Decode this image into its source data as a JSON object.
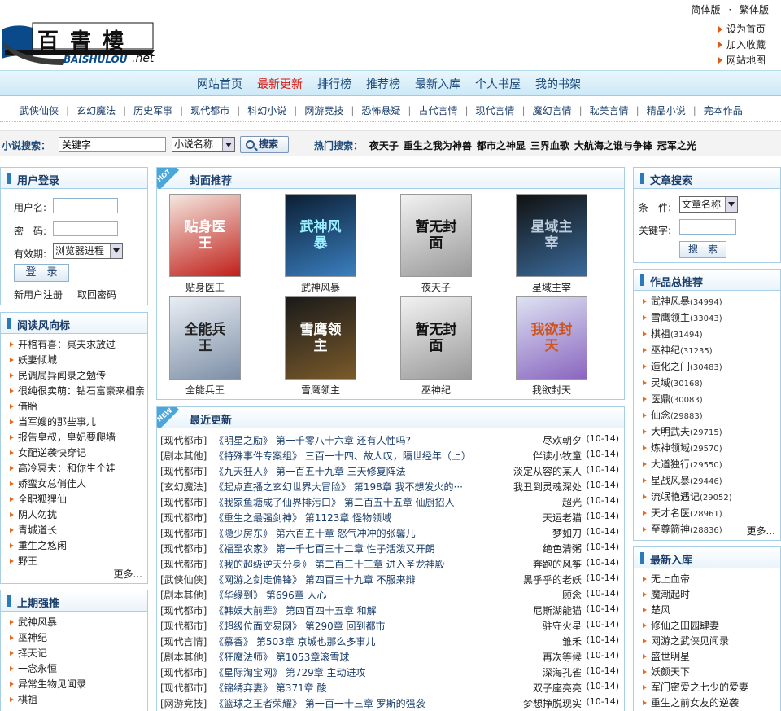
{
  "header": {
    "logo_text": "百書樓",
    "logo_sub": "BAISHULOU",
    "logo_tld": ".net",
    "lang_simplified": "简体版",
    "lang_dot": "·",
    "lang_traditional": "繁体版",
    "links": [
      "设为首页",
      "加入收藏",
      "网站地图"
    ]
  },
  "main_nav": [
    "网站首页",
    "最新更新",
    "排行榜",
    "推荐榜",
    "最新入库",
    "个人书屋",
    "我的书架"
  ],
  "main_nav_active": "最新更新",
  "categories": [
    "武侠仙侠",
    "玄幻魔法",
    "历史军事",
    "现代都市",
    "科幻小说",
    "网游竞技",
    "恐怖悬疑",
    "古代言情",
    "现代言情",
    "魔幻言情",
    "耽美言情",
    "精品小说",
    "完本作品"
  ],
  "search": {
    "label": "小说搜索：",
    "value": "关键字",
    "type": "小说名称",
    "button": "搜索",
    "hot_label": "热门搜索：",
    "hot": [
      "夜天子",
      "重生之我为神兽",
      "都市之神显",
      "三界血歌",
      "大航海之谁与争锋",
      "冠军之光"
    ]
  },
  "login": {
    "title": "用户登录",
    "username_label": "用户名:",
    "password_label": "密　码:",
    "expiry_label": "有效期:",
    "expiry_value": "浏览器进程",
    "submit": "登　录",
    "register": "新用户注册",
    "recover": "取回密码"
  },
  "reading_trend": {
    "title": "阅读风向标",
    "items": [
      "开棺有喜：冥夫求放过",
      "妖妻倾城",
      "民调局异闻录之勉传",
      "很纯很卖萌：钻石富豪来相亲",
      "借胎",
      "当军嫂的那些事儿",
      "报告皇叔，皇妃要爬墙",
      "女配逆袭快穿记",
      "高冷冥夫：和你生个娃",
      "娇蛮女总俏佳人",
      "全职狐狸仙",
      "阴人勿扰",
      "青城道长",
      "重生之悠闲",
      "野王"
    ],
    "more": "更多..."
  },
  "last_period": {
    "title": "上期强推",
    "items": [
      "武神风暴",
      "巫神纪",
      "择天记",
      "一念永恒",
      "异常生物见闻录",
      "棋祖"
    ]
  },
  "cover_rec": {
    "title": "封面推荐",
    "ribbon": "HOT",
    "books": [
      {
        "name": "贴身医王",
        "cover_text": "贴身医王"
      },
      {
        "name": "武神风暴",
        "cover_text": "武神风暴"
      },
      {
        "name": "夜天子",
        "cover_text": "暂无封面"
      },
      {
        "name": "星域主宰",
        "cover_text": "星域主宰"
      },
      {
        "name": "全能兵王",
        "cover_text": "全能兵王"
      },
      {
        "name": "雪鹰领主",
        "cover_text": "雪鹰领主"
      },
      {
        "name": "巫神纪",
        "cover_text": "暂无封面"
      },
      {
        "name": "我欲封天",
        "cover_text": "我欲封天"
      }
    ]
  },
  "latest": {
    "title": "最近更新",
    "ribbon": "NEW",
    "rows": [
      {
        "cat": "[现代都市]",
        "book": "《明星之励》 第一千零八十六章 还有人性吗?",
        "author": "尽欢朝夕",
        "date": "(10-14)"
      },
      {
        "cat": "[剧本其他]",
        "book": "《特殊事件专案组》 三百一十四、故人叹，隔世经年（上）",
        "author": "伴读小牧童",
        "date": "(10-14)"
      },
      {
        "cat": "[现代都市]",
        "book": "《九天狂人》 第一百五十九章 三天修复阵法",
        "author": "淡定从容的某人",
        "date": "(10-14)"
      },
      {
        "cat": "[玄幻魔法]",
        "book": "《起点直播之玄幻世界大冒险》 第198章 我不想发火的···",
        "author": "我丑到灵魂深处",
        "date": "(10-14)"
      },
      {
        "cat": "[现代都市]",
        "book": "《我家鱼塘成了仙界排污口》 第二百五十五章 仙厨招人",
        "author": "超光",
        "date": "(10-14)"
      },
      {
        "cat": "[现代都市]",
        "book": "《重生之最强剑神》 第1123章 怪物领域",
        "author": "天运老猫",
        "date": "(10-14)"
      },
      {
        "cat": "[现代都市]",
        "book": "《隐少房东》 第六百五十章 怒气冲冲的张馨儿",
        "author": "梦如刀",
        "date": "(10-14)"
      },
      {
        "cat": "[现代都市]",
        "book": "《福至农家》 第一千七百三十二章 性子活泼又开朗",
        "author": "绝色清粥",
        "date": "(10-14)"
      },
      {
        "cat": "[现代都市]",
        "book": "《我的超级逆天分身》 第二百三十三章 进入圣龙神殿",
        "author": "奔跑的风筝",
        "date": "(10-14)"
      },
      {
        "cat": "[武侠仙侠]",
        "book": "《网游之剑走偏锋》 第四百三十九章 不服来辩",
        "author": "黑乎乎的老妖",
        "date": "(10-14)"
      },
      {
        "cat": "[剧本其他]",
        "book": "《华缘到》 第696章 人心",
        "author": "顾念",
        "date": "(10-14)"
      },
      {
        "cat": "[现代都市]",
        "book": "《韩娱大前辈》 第四百四十五章 和解",
        "author": "尼斯湖能猫",
        "date": "(10-14)"
      },
      {
        "cat": "[现代都市]",
        "book": "《超级位面交易网》 第290章 回到都市",
        "author": "驻守火星",
        "date": "(10-14)"
      },
      {
        "cat": "[现代言情]",
        "book": "《慕香》 第503章 京城也那么多事儿",
        "author": "雏禾",
        "date": "(10-14)"
      },
      {
        "cat": "[剧本其他]",
        "book": "《狂魔法师》 第1053章滚雪球",
        "author": "再次等候",
        "date": "(10-14)"
      },
      {
        "cat": "[现代都市]",
        "book": "《星际淘宝网》 第729章 主动进攻",
        "author": "深海孔雀",
        "date": "(10-14)"
      },
      {
        "cat": "[现代都市]",
        "book": "《锦绣弃妻》 第371章 酸",
        "author": "双子座亮亮",
        "date": "(10-14)"
      },
      {
        "cat": "[网游竞技]",
        "book": "《篮球之王者荣耀》 第一百一十三章 罗斯的强袭",
        "author": "梦想挣脱现实",
        "date": "(10-14)"
      }
    ]
  },
  "article_search": {
    "title": "文章搜索",
    "cond_label": "条　件:",
    "cond_value": "文章名称",
    "kw_label": "关键字:",
    "button": "搜　索"
  },
  "overall_rec": {
    "title": "作品总推荐",
    "items": [
      {
        "name": "武神风暴",
        "count": "(34994)"
      },
      {
        "name": "雪鹰领主",
        "count": "(33043)"
      },
      {
        "name": "棋祖",
        "count": "(31494)"
      },
      {
        "name": "巫神纪",
        "count": "(31235)"
      },
      {
        "name": "造化之门",
        "count": "(30483)"
      },
      {
        "name": "灵域",
        "count": "(30168)"
      },
      {
        "name": "医鼎",
        "count": "(30083)"
      },
      {
        "name": "仙念",
        "count": "(29883)"
      },
      {
        "name": "大明武夫",
        "count": "(29715)"
      },
      {
        "name": "炼神领域",
        "count": "(29570)"
      },
      {
        "name": "大道独行",
        "count": "(29550)"
      },
      {
        "name": "星战风暴",
        "count": "(29446)"
      },
      {
        "name": "流氓艳遇记",
        "count": "(29052)"
      },
      {
        "name": "天才名医",
        "count": "(28961)"
      },
      {
        "name": "至尊箭神",
        "count": "(28836)"
      }
    ],
    "more": "更多..."
  },
  "newest": {
    "title": "最新入库",
    "items": [
      "无上血帝",
      "魔潮起时",
      "楚风",
      "修仙之田园肆妻",
      "网游之武侠见闻录",
      "盛世明星",
      "妖颜天下",
      "军门密爱之七少的爱妻",
      "重生之前女友的逆袭"
    ]
  }
}
